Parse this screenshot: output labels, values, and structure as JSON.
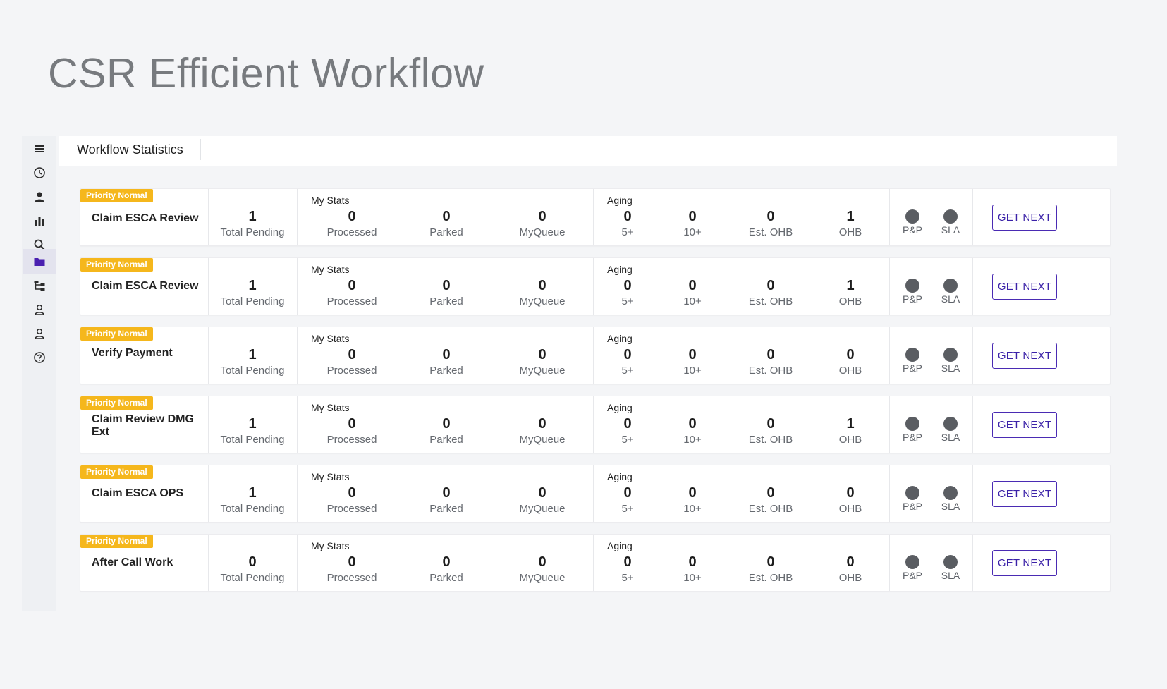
{
  "page_title": "CSR Efficient Workflow",
  "header": {
    "tab_label": "Workflow Statistics"
  },
  "sidebar": {
    "items": [
      {
        "icon": "menu-icon"
      },
      {
        "icon": "clock-icon"
      },
      {
        "icon": "user-icon"
      },
      {
        "icon": "bar-chart-icon"
      },
      {
        "icon": "search-icon"
      },
      {
        "icon": "folder-icon",
        "active": true
      },
      {
        "icon": "hierarchy-icon"
      },
      {
        "icon": "user-outline-icon"
      },
      {
        "icon": "user-outline-icon"
      },
      {
        "icon": "help-icon"
      }
    ]
  },
  "labels": {
    "total_pending": "Total Pending",
    "my_stats": "My Stats",
    "processed": "Processed",
    "parked": "Parked",
    "myqueue": "MyQueue",
    "aging": "Aging",
    "aging_5": "5+",
    "aging_10": "10+",
    "est_ohb": "Est. OHB",
    "ohb": "OHB",
    "pp": "P&P",
    "sla": "SLA",
    "get_next": "GET NEXT"
  },
  "colors": {
    "badge": "#f5b71c",
    "accent": "#3b22a8",
    "status_dot": "#5a5d62"
  },
  "workflows": [
    {
      "priority": "Priority Normal",
      "name": "Claim ESCA Review",
      "total_pending": "1",
      "processed": "0",
      "parked": "0",
      "myqueue": "0",
      "aging_5": "0",
      "aging_10": "0",
      "est_ohb": "0",
      "ohb": "1"
    },
    {
      "priority": "Priority Normal",
      "name": "Claim ESCA Review",
      "total_pending": "1",
      "processed": "0",
      "parked": "0",
      "myqueue": "0",
      "aging_5": "0",
      "aging_10": "0",
      "est_ohb": "0",
      "ohb": "1"
    },
    {
      "priority": "Priority Normal",
      "name": "Verify Payment",
      "total_pending": "1",
      "processed": "0",
      "parked": "0",
      "myqueue": "0",
      "aging_5": "0",
      "aging_10": "0",
      "est_ohb": "0",
      "ohb": "0"
    },
    {
      "priority": "Priority Normal",
      "name": "Claim Review DMG Ext",
      "total_pending": "1",
      "processed": "0",
      "parked": "0",
      "myqueue": "0",
      "aging_5": "0",
      "aging_10": "0",
      "est_ohb": "0",
      "ohb": "1"
    },
    {
      "priority": "Priority Normal",
      "name": "Claim ESCA OPS",
      "total_pending": "1",
      "processed": "0",
      "parked": "0",
      "myqueue": "0",
      "aging_5": "0",
      "aging_10": "0",
      "est_ohb": "0",
      "ohb": "0"
    },
    {
      "priority": "Priority Normal",
      "name": "After Call Work",
      "total_pending": "0",
      "processed": "0",
      "parked": "0",
      "myqueue": "0",
      "aging_5": "0",
      "aging_10": "0",
      "est_ohb": "0",
      "ohb": "0"
    }
  ]
}
